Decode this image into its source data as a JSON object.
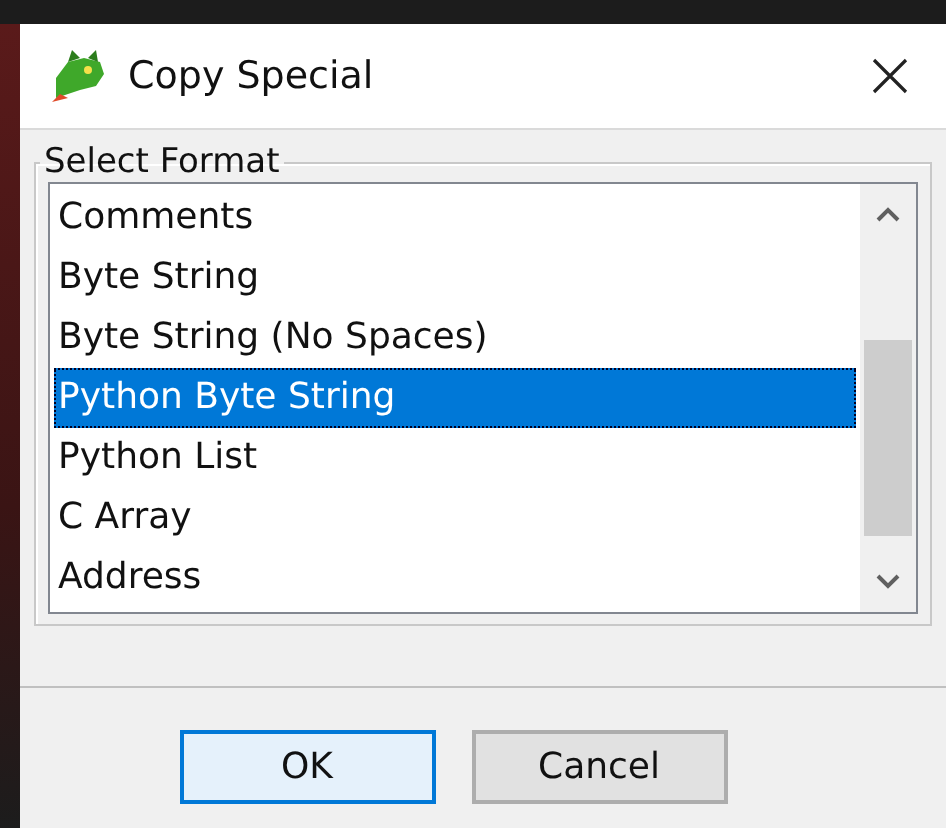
{
  "window": {
    "title": "Copy Special"
  },
  "group": {
    "label": "Select Format"
  },
  "list": {
    "items": [
      {
        "label": "Comments",
        "selected": false
      },
      {
        "label": "Byte String",
        "selected": false
      },
      {
        "label": "Byte String (No Spaces)",
        "selected": false
      },
      {
        "label": "Python Byte String",
        "selected": true
      },
      {
        "label": "Python List",
        "selected": false
      },
      {
        "label": "C Array",
        "selected": false
      },
      {
        "label": "Address",
        "selected": false
      }
    ]
  },
  "buttons": [
    {
      "label": "OK",
      "default": true
    },
    {
      "label": "Cancel",
      "default": false
    }
  ]
}
